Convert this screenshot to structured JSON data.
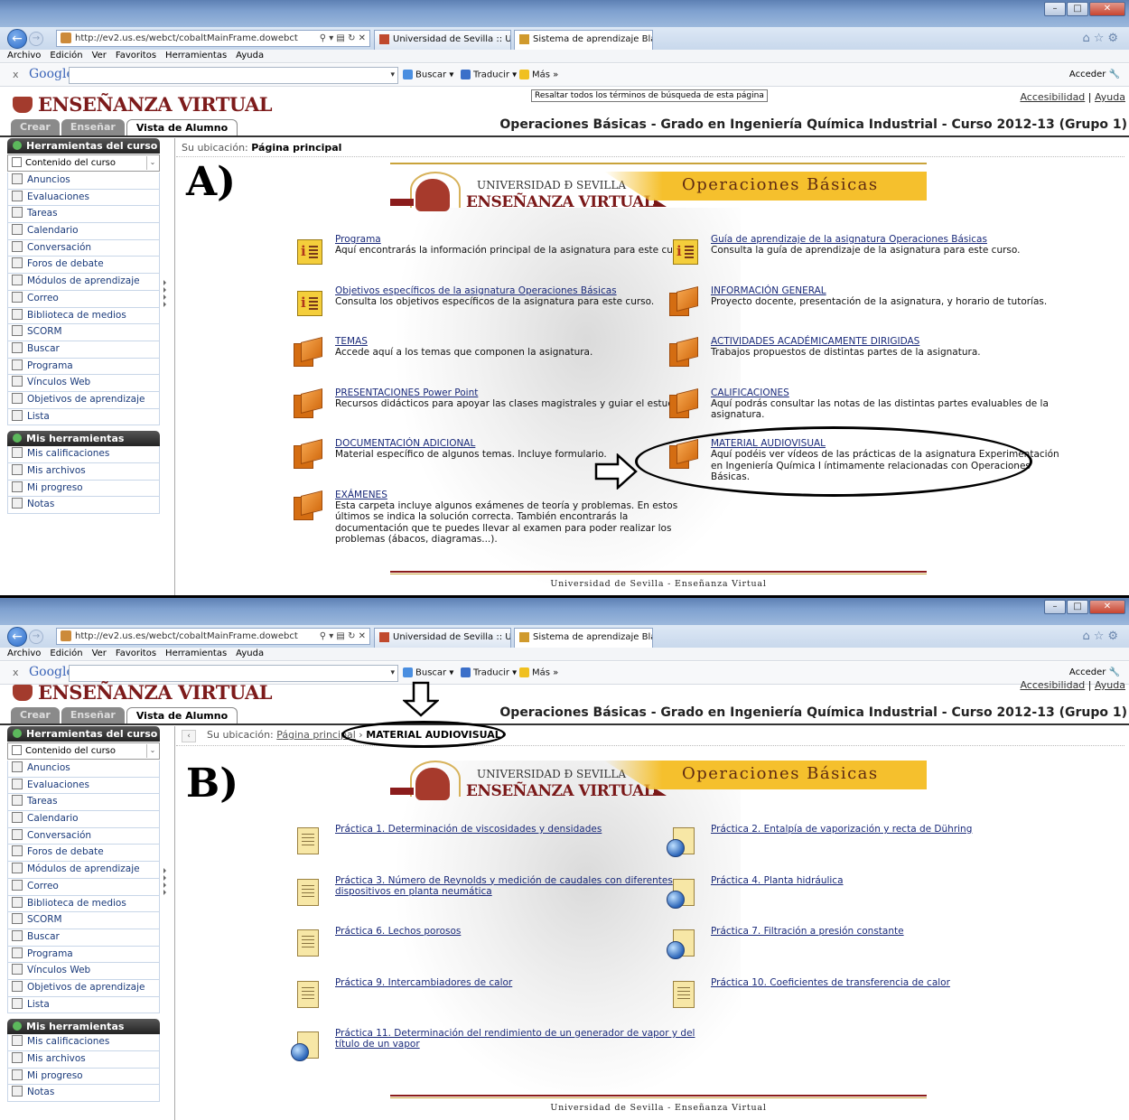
{
  "browser": {
    "url": "http://ev2.us.es/webct/cobaltMainFrame.dowebct",
    "tab1": "Universidad de Sevilla :: Univer...",
    "tab2": "Sistema de aprendizaje Blac...",
    "menu": [
      "Archivo",
      "Edición",
      "Ver",
      "Favoritos",
      "Herramientas",
      "Ayuda"
    ],
    "google_x": "x",
    "google_logo": "Google",
    "buscar": "Buscar",
    "traducir": "Traducir",
    "mas": "Más »",
    "acceder": "Acceder",
    "tooltip": "Resaltar todos los términos de búsqueda de esta página"
  },
  "header": {
    "logo_text": "ENSEÑANZA VIRTUAL",
    "accesibilidad": "Accesibilidad",
    "separator": "|",
    "ayuda": "Ayuda",
    "tabs": [
      "Crear",
      "Enseñar",
      "Vista de Alumno"
    ],
    "course_title": "Operaciones Básicas - Grado en Ingeniería Química Industrial - Curso 2012-13 (Grupo 1)"
  },
  "sidebar": {
    "tools_header": "Herramientas del curso",
    "select_value": "Contenido del curso",
    "items": [
      "Anuncios",
      "Evaluaciones",
      "Tareas",
      "Calendario",
      "Conversación",
      "Foros de debate",
      "Módulos de aprendizaje",
      "Correo",
      "Biblioteca de medios",
      "SCORM",
      "Buscar",
      "Programa",
      "Vínculos Web",
      "Objetivos de aprendizaje",
      "Lista"
    ],
    "my_header": "Mis herramientas",
    "my_items": [
      "Mis calificaciones",
      "Mis archivos",
      "Mi progreso",
      "Notas"
    ]
  },
  "panelA": {
    "label": "A)",
    "location_prefix": "Su ubicación:",
    "location_current": "Página principal",
    "banner_univ": "UNIVERSIDAD Ð SEVILLA",
    "banner_ev": "ENSEÑANZA VIRTUAL",
    "banner_subject": "Operaciones Básicas",
    "left": [
      {
        "title": "Programa",
        "desc": "Aquí encontrarás la información principal de la asignatura para este curso.",
        "icon": "info-icon"
      },
      {
        "title": "Objetivos específicos de la asignatura Operaciones Básicas",
        "desc": "Consulta los objetivos específicos de la asignatura para este curso.",
        "icon": "info-icon"
      },
      {
        "title": "TEMAS",
        "desc": "Accede aquí a los temas que componen la asignatura.",
        "icon": "folder-icon"
      },
      {
        "title": "PRESENTACIONES Power Point",
        "desc": "Recursos didácticos para apoyar las clases magistrales y guiar el estudio.",
        "icon": "folder-icon"
      },
      {
        "title": "DOCUMENTACIÓN ADICIONAL",
        "desc": "Material específico de algunos temas. Incluye formulario.",
        "icon": "folder-icon"
      },
      {
        "title": "EXÁMENES",
        "desc": "Esta carpeta incluye algunos exámenes de teoría y problemas. En estos últimos se indica la solución correcta. También encontrarás la documentación que te puedes llevar al examen para poder realizar los problemas (ábacos, diagramas...).",
        "icon": "folder-icon"
      }
    ],
    "right": [
      {
        "title": "Guía de aprendizaje de la asignatura Operaciones Básicas",
        "desc": "Consulta la guía de aprendizaje de la asignatura para este curso.",
        "icon": "info-icon"
      },
      {
        "title": "INFORMACIÓN GENERAL",
        "desc": "Proyecto docente, presentación de la asignatura, y horario de tutorías.",
        "icon": "folder-icon"
      },
      {
        "title": "ACTIVIDADES ACADÉMICAMENTE DIRIGIDAS",
        "desc": "Trabajos propuestos de distintas partes de la asignatura.",
        "icon": "folder-icon"
      },
      {
        "title": "CALIFICACIONES",
        "desc": "Aquí podrás consultar las notas de las distintas partes evaluables de la asignatura.",
        "icon": "folder-icon"
      },
      {
        "title": "MATERIAL AUDIOVISUAL",
        "desc": "Aquí podéis ver vídeos de las prácticas de la asignatura Experimentación en Ingeniería Química I íntimamente relacionadas con Operaciones Básicas.",
        "icon": "folder-icon"
      }
    ],
    "footer": "Universidad de Sevilla - Enseñanza Virtual"
  },
  "panelB": {
    "label": "B)",
    "location_prefix": "Su ubicación:",
    "location_parent": "Página principal",
    "location_current": "MATERIAL AUDIOVISUAL",
    "left": [
      {
        "title": "Práctica 1. Determinación de viscosidades y densidades",
        "icon": "document-icon"
      },
      {
        "title": "Práctica 3. Número de Reynolds y medición de caudales con diferentes dispositivos en planta neumática",
        "icon": "document-icon"
      },
      {
        "title": "Práctica 6. Lechos porosos",
        "icon": "document-icon"
      },
      {
        "title": "Práctica 9. Intercambiadores de calor",
        "icon": "document-icon"
      },
      {
        "title": "Práctica 11. Determinación del rendimiento de un generador de vapor y del título de un vapor",
        "icon": "weblink-icon"
      }
    ],
    "right": [
      {
        "title": "Práctica 2. Entalpía de vaporización y recta de Dühring",
        "icon": "weblink-icon"
      },
      {
        "title": "Práctica 4. Planta hidráulica",
        "icon": "weblink-icon"
      },
      {
        "title": "Práctica 7. Filtración a presión constante",
        "icon": "weblink-icon"
      },
      {
        "title": "Práctica 10. Coeficientes de transferencia de calor",
        "icon": "document-icon"
      }
    ],
    "footer": "Universidad de Sevilla - Enseñanza Virtual"
  }
}
